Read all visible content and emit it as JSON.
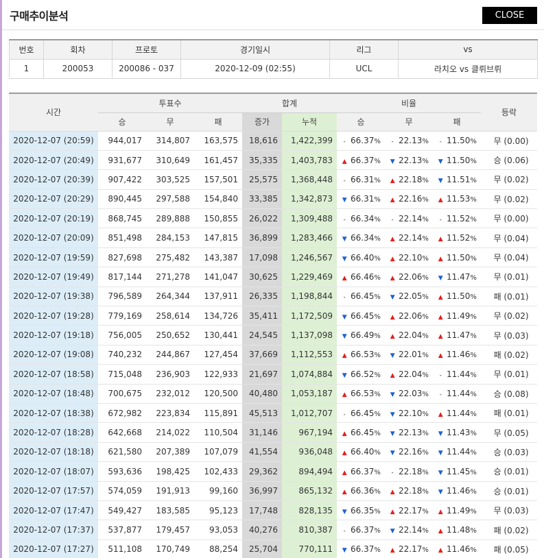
{
  "dialog": {
    "title": "구매추이분석",
    "close_label": "CLOSE"
  },
  "info": {
    "headers": [
      "번호",
      "회차",
      "프로토",
      "경기일시",
      "리그",
      "vs"
    ],
    "row": [
      "1",
      "200053",
      "200086 - 037",
      "2020-12-09 (02:55)",
      "UCL",
      "라치오 vs 클뤼브뤼"
    ]
  },
  "table": {
    "h_time": "시간",
    "h_votes": "투표수",
    "h_sum": "합계",
    "h_ratio": "비율",
    "h_result": "등락",
    "h_win": "승",
    "h_draw": "무",
    "h_loss": "패",
    "h_inc": "증가",
    "h_cum": "누적",
    "h_rwin": "승",
    "h_rdraw": "무",
    "h_rloss": "패",
    "pct_sign": "%",
    "arrows": {
      "up": "▲",
      "down": "▼",
      "same": "-"
    },
    "rows": [
      {
        "time": "2020-12-07 (20:59)",
        "w": "944,017",
        "d": "314,807",
        "l": "163,575",
        "inc": "18,616",
        "cum": "1,422,399",
        "rw": "66.37",
        "rwa": "same",
        "rd": "22.13",
        "rda": "same",
        "rl": "11.50",
        "rla": "same",
        "res": "무 (0.00)"
      },
      {
        "time": "2020-12-07 (20:49)",
        "w": "931,677",
        "d": "310,649",
        "l": "161,457",
        "inc": "35,335",
        "cum": "1,403,783",
        "rw": "66.37",
        "rwa": "up",
        "rd": "22.13",
        "rda": "down",
        "rl": "11.50",
        "rla": "down",
        "res": "승 (0.06)"
      },
      {
        "time": "2020-12-07 (20:39)",
        "w": "907,422",
        "d": "303,525",
        "l": "157,501",
        "inc": "25,575",
        "cum": "1,368,448",
        "rw": "66.31",
        "rwa": "same",
        "rd": "22.18",
        "rda": "up",
        "rl": "11.51",
        "rla": "down",
        "res": "무 (0.02)"
      },
      {
        "time": "2020-12-07 (20:29)",
        "w": "890,445",
        "d": "297,588",
        "l": "154,840",
        "inc": "33,385",
        "cum": "1,342,873",
        "rw": "66.31",
        "rwa": "down",
        "rd": "22.16",
        "rda": "up",
        "rl": "11.53",
        "rla": "up",
        "res": "무 (0.02)"
      },
      {
        "time": "2020-12-07 (20:19)",
        "w": "868,745",
        "d": "289,888",
        "l": "150,855",
        "inc": "26,022",
        "cum": "1,309,488",
        "rw": "66.34",
        "rwa": "same",
        "rd": "22.14",
        "rda": "same",
        "rl": "11.52",
        "rla": "same",
        "res": "무 (0.00)"
      },
      {
        "time": "2020-12-07 (20:09)",
        "w": "851,498",
        "d": "284,153",
        "l": "147,815",
        "inc": "36,899",
        "cum": "1,283,466",
        "rw": "66.34",
        "rwa": "down",
        "rd": "22.14",
        "rda": "up",
        "rl": "11.52",
        "rla": "up",
        "res": "무 (0.04)"
      },
      {
        "time": "2020-12-07 (19:59)",
        "w": "827,698",
        "d": "275,482",
        "l": "143,387",
        "inc": "17,098",
        "cum": "1,246,567",
        "rw": "66.40",
        "rwa": "down",
        "rd": "22.10",
        "rda": "up",
        "rl": "11.50",
        "rla": "up",
        "res": "무 (0.04)"
      },
      {
        "time": "2020-12-07 (19:49)",
        "w": "817,144",
        "d": "271,278",
        "l": "141,047",
        "inc": "30,625",
        "cum": "1,229,469",
        "rw": "66.46",
        "rwa": "up",
        "rd": "22.06",
        "rda": "up",
        "rl": "11.47",
        "rla": "down",
        "res": "무 (0.01)"
      },
      {
        "time": "2020-12-07 (19:38)",
        "w": "796,589",
        "d": "264,344",
        "l": "137,911",
        "inc": "26,335",
        "cum": "1,198,844",
        "rw": "66.45",
        "rwa": "same",
        "rd": "22.05",
        "rda": "down",
        "rl": "11.50",
        "rla": "up",
        "res": "패 (0.01)"
      },
      {
        "time": "2020-12-07 (19:28)",
        "w": "779,169",
        "d": "258,614",
        "l": "134,726",
        "inc": "35,411",
        "cum": "1,172,509",
        "rw": "66.45",
        "rwa": "down",
        "rd": "22.06",
        "rda": "up",
        "rl": "11.49",
        "rla": "up",
        "res": "무 (0.02)"
      },
      {
        "time": "2020-12-07 (19:18)",
        "w": "756,005",
        "d": "250,652",
        "l": "130,441",
        "inc": "24,545",
        "cum": "1,137,098",
        "rw": "66.49",
        "rwa": "down",
        "rd": "22.04",
        "rda": "up",
        "rl": "11.47",
        "rla": "up",
        "res": "무 (0.03)"
      },
      {
        "time": "2020-12-07 (19:08)",
        "w": "740,232",
        "d": "244,867",
        "l": "127,454",
        "inc": "37,669",
        "cum": "1,112,553",
        "rw": "66.53",
        "rwa": "up",
        "rd": "22.01",
        "rda": "down",
        "rl": "11.46",
        "rla": "up",
        "res": "패 (0.02)"
      },
      {
        "time": "2020-12-07 (18:58)",
        "w": "715,048",
        "d": "236,903",
        "l": "122,933",
        "inc": "21,697",
        "cum": "1,074,884",
        "rw": "66.52",
        "rwa": "down",
        "rd": "22.04",
        "rda": "up",
        "rl": "11.44",
        "rla": "same",
        "res": "무 (0.01)"
      },
      {
        "time": "2020-12-07 (18:48)",
        "w": "700,675",
        "d": "232,012",
        "l": "120,500",
        "inc": "40,480",
        "cum": "1,053,187",
        "rw": "66.53",
        "rwa": "up",
        "rd": "22.03",
        "rda": "down",
        "rl": "11.44",
        "rla": "same",
        "res": "승 (0.08)"
      },
      {
        "time": "2020-12-07 (18:38)",
        "w": "672,982",
        "d": "223,834",
        "l": "115,891",
        "inc": "45,513",
        "cum": "1,012,707",
        "rw": "66.45",
        "rwa": "same",
        "rd": "22.10",
        "rda": "down",
        "rl": "11.44",
        "rla": "up",
        "res": "패 (0.01)"
      },
      {
        "time": "2020-12-07 (18:28)",
        "w": "642,668",
        "d": "214,022",
        "l": "110,504",
        "inc": "31,146",
        "cum": "967,194",
        "rw": "66.45",
        "rwa": "up",
        "rd": "22.13",
        "rda": "down",
        "rl": "11.43",
        "rla": "down",
        "res": "무 (0.05)"
      },
      {
        "time": "2020-12-07 (18:18)",
        "w": "621,580",
        "d": "207,389",
        "l": "107,079",
        "inc": "41,554",
        "cum": "936,048",
        "rw": "66.40",
        "rwa": "up",
        "rd": "22.16",
        "rda": "down",
        "rl": "11.44",
        "rla": "down",
        "res": "승 (0.03)"
      },
      {
        "time": "2020-12-07 (18:07)",
        "w": "593,636",
        "d": "198,425",
        "l": "102,433",
        "inc": "29,362",
        "cum": "894,494",
        "rw": "66.37",
        "rwa": "up",
        "rd": "22.18",
        "rda": "same",
        "rl": "11.45",
        "rla": "down",
        "res": "승 (0.01)"
      },
      {
        "time": "2020-12-07 (17:57)",
        "w": "574,059",
        "d": "191,913",
        "l": "99,160",
        "inc": "36,997",
        "cum": "865,132",
        "rw": "66.36",
        "rwa": "up",
        "rd": "22.18",
        "rda": "up",
        "rl": "11.46",
        "rla": "down",
        "res": "승 (0.01)"
      },
      {
        "time": "2020-12-07 (17:47)",
        "w": "549,427",
        "d": "183,585",
        "l": "95,123",
        "inc": "17,748",
        "cum": "828,135",
        "rw": "66.35",
        "rwa": "down",
        "rd": "22.17",
        "rda": "up",
        "rl": "11.49",
        "rla": "up",
        "res": "무 (0.03)"
      },
      {
        "time": "2020-12-07 (17:37)",
        "w": "537,877",
        "d": "179,457",
        "l": "93,053",
        "inc": "40,276",
        "cum": "810,387",
        "rw": "66.37",
        "rwa": "same",
        "rd": "22.14",
        "rda": "down",
        "rl": "11.48",
        "rla": "up",
        "res": "패 (0.02)"
      },
      {
        "time": "2020-12-07 (17:27)",
        "w": "511,108",
        "d": "170,749",
        "l": "88,254",
        "inc": "25,704",
        "cum": "770,111",
        "rw": "66.37",
        "rwa": "down",
        "rd": "22.17",
        "rda": "up",
        "rl": "11.46",
        "rla": "up",
        "res": "패 (0.05)"
      }
    ]
  }
}
